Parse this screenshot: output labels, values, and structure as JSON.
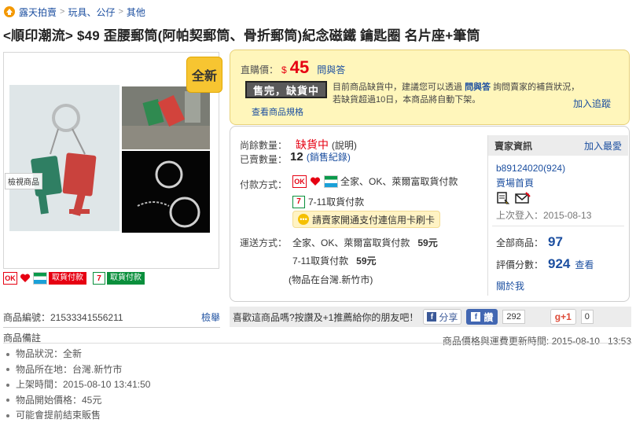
{
  "breadcrumb": {
    "site": "露天拍賣",
    "items": [
      "玩具、公仔",
      "其他"
    ]
  },
  "title": "<順印潮流> $49 歪腰郵筒(阿帕契郵筒、骨折郵筒)紀念磁鐵 鑰匙圈 名片座+筆筒",
  "gallery": {
    "view_label": "檢視商品",
    "badge": "全新"
  },
  "pay_icons": {
    "cod1": "取貨付款",
    "cod2": "取貨付款"
  },
  "price": {
    "label": "直購價：",
    "currency": "$",
    "amount": "45",
    "qa_link": "問與答",
    "soldout_label": "售完，缺貨中",
    "soldout_note_1": "目前商品缺貨中，建議您可以透過",
    "soldout_note_link": "問與答",
    "soldout_note_2": "詢問賣家的補貨狀況，若缺貨超過10日，本商品將自動下架。",
    "spec_link": "查看商品規格",
    "follow_link": "加入追蹤"
  },
  "stock": {
    "remain_label": "尚餘數量：",
    "remain_value": "缺貨中",
    "remain_note": "(說明)",
    "sold_label": "已賣數量：",
    "sold_value": "12",
    "sold_note": "(銷售紀錄)"
  },
  "payment": {
    "label": "付款方式：",
    "methods": "全家、OK、萊爾富取貨付款",
    "method_711": "7-11取貨付款",
    "card_note": "請賣家開通支付連信用卡刷卡"
  },
  "shipping": {
    "label": "運送方式：",
    "line1": "全家、OK、萊爾富取貨付款",
    "fee1": "59元",
    "line2": "7-11取貨付款",
    "fee2": "59元",
    "location": "(物品在台灣.新竹市)"
  },
  "seller": {
    "header": "賣家資訊",
    "favorite": "加入最愛",
    "id": "b89124020(924)",
    "store": "賣場首頁",
    "last_login": "上次登入：2015-08-13",
    "all_items_label": "全部商品：",
    "all_items_value": "97",
    "rating_label": "評價分數：",
    "rating_value": "924",
    "rating_link": "查看",
    "about": "關於我"
  },
  "share": {
    "prompt": "喜歡這商品嗎?按讚及+1推薦給你的朋友吧！",
    "share_label": "分享",
    "like_label": "讚",
    "like_count": "292",
    "gplus_label": "g+1",
    "gplus_count": "0"
  },
  "item": {
    "number_label": "商品編號：21533341556211",
    "report": "檢舉",
    "notes_title": "商品備註",
    "update_time": "商品價格與運費更新時間: 2015-08-10   13:53",
    "notes": [
      "物品狀況：全新",
      "物品所在地：台灣.新竹市",
      "上架時間：2015-08-10 13:41:50",
      "物品開始價格：45元",
      "可能會提前結束販售"
    ]
  }
}
